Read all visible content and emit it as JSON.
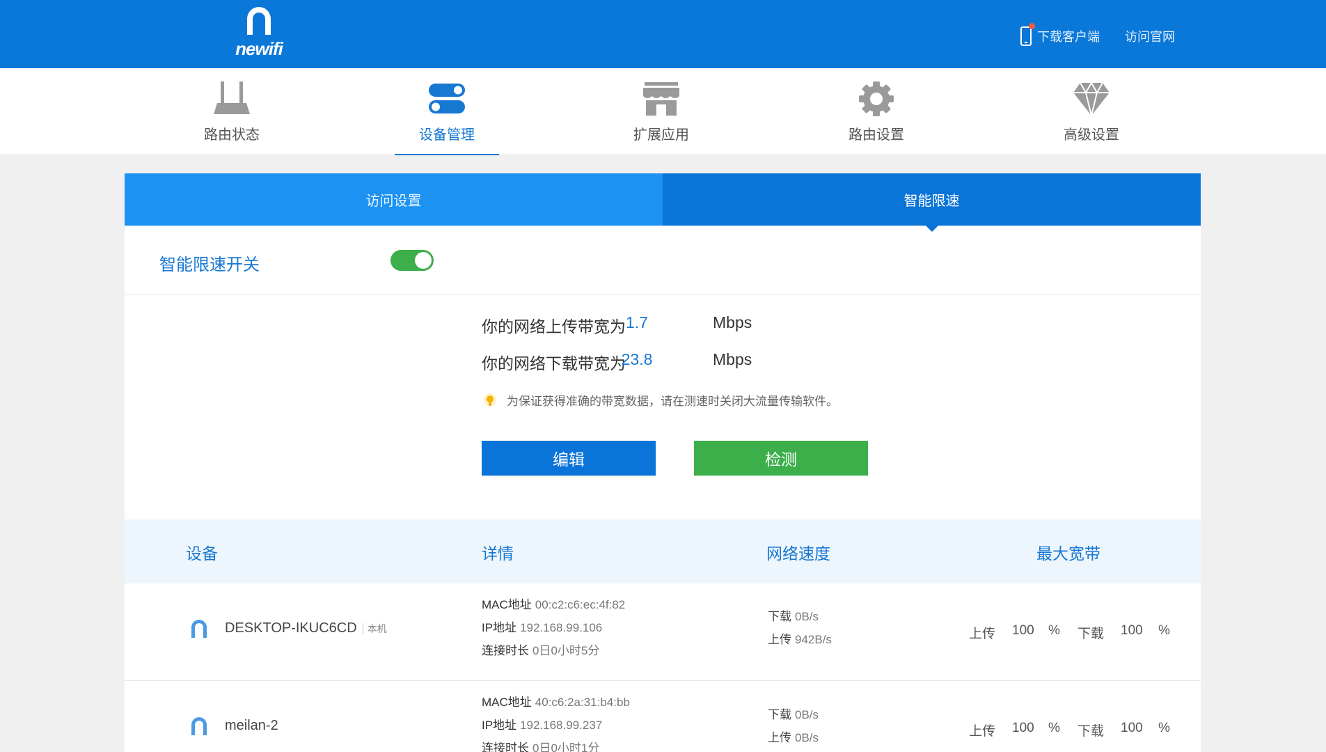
{
  "header": {
    "logo_text": "newifi",
    "download_client": "下载客户端",
    "visit_site": "访问官网"
  },
  "nav": [
    {
      "label": "路由状态",
      "icon": "router-icon"
    },
    {
      "label": "设备管理",
      "icon": "devices-toggle-icon",
      "active": true
    },
    {
      "label": "扩展应用",
      "icon": "store-icon"
    },
    {
      "label": "路由设置",
      "icon": "gear-icon"
    },
    {
      "label": "高级设置",
      "icon": "diamond-icon"
    }
  ],
  "tabs": {
    "access": "访问设置",
    "smart_limit": "智能限速"
  },
  "switch": {
    "label": "智能限速开关",
    "on": true
  },
  "bandwidth": {
    "upload_label": "你的网络上传带宽为",
    "upload_value": "1.7",
    "download_label": "你的网络下载带宽为",
    "download_value": "23.8",
    "unit": "Mbps",
    "tip": "为保证获得准确的带宽数据，请在测速时关闭大流量传输软件。",
    "edit_button": "编辑",
    "test_button": "检测"
  },
  "table": {
    "headers": [
      "设备",
      "详情",
      "网络速度",
      "最大宽带"
    ],
    "rows": [
      {
        "name": "DESKTOP-IKUC6CD",
        "tag": "本机",
        "mac_label": "MAC地址",
        "mac": "00:c2:c6:ec:4f:82",
        "ip_label": "IP地址",
        "ip": "192.168.99.106",
        "time_label": "连接时长",
        "time": "0日0小时5分",
        "down_label": "下载",
        "down": "0B/s",
        "up_label": "上传",
        "up": "942B/s",
        "limit_up_label": "上传",
        "limit_up": "100",
        "limit_down_label": "下载",
        "limit_down": "100",
        "percent": "%"
      },
      {
        "name": "meilan-2",
        "tag": "",
        "mac_label": "MAC地址",
        "mac": "40:c6:2a:31:b4:bb",
        "ip_label": "IP地址",
        "ip": "192.168.99.237",
        "time_label": "连接时长",
        "time": "0日0小时1分",
        "down_label": "下载",
        "down": "0B/s",
        "up_label": "上传",
        "up": "0B/s",
        "limit_up_label": "上传",
        "limit_up": "100",
        "limit_down_label": "下载",
        "limit_down": "100",
        "percent": "%"
      }
    ]
  },
  "colors": {
    "brand_blue": "#0a78d8",
    "tab_light": "#1c93f2",
    "accent_green": "#3caf4b",
    "link_blue": "#1778d2"
  }
}
